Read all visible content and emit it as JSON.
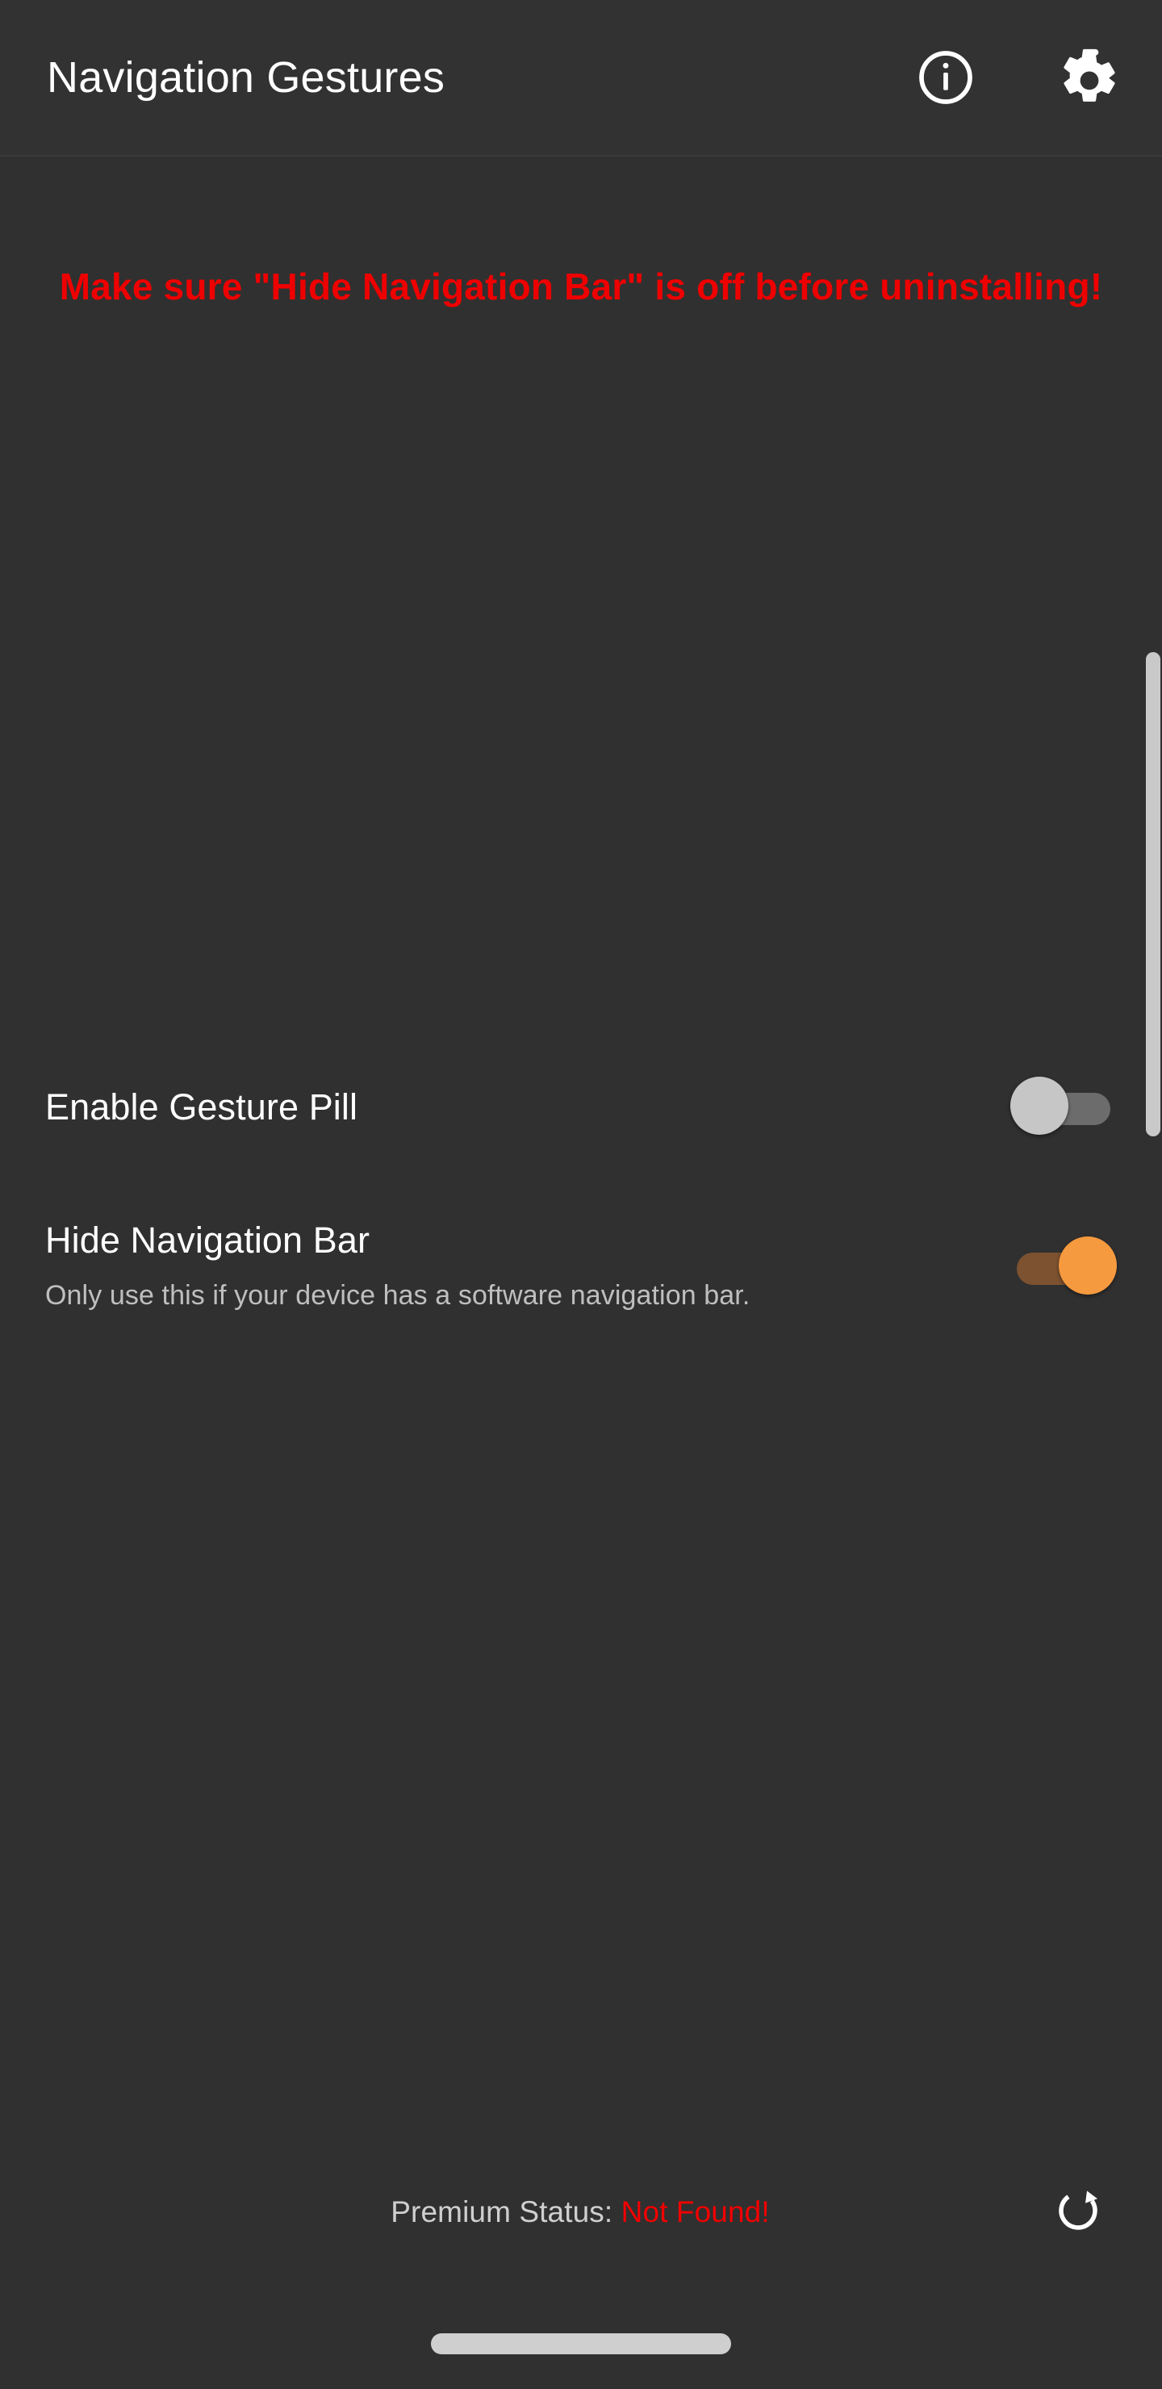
{
  "app": {
    "title": "Navigation Gestures",
    "theme": {
      "background": "#303030",
      "appbar_background": "#323232",
      "accent": "#f69a3f",
      "warning_red": "#ee0000",
      "primary_text": "#ffffff",
      "secondary_text": "#bfbfbf"
    }
  },
  "appbar": {
    "title": "Navigation Gestures",
    "actions": [
      {
        "name": "info-icon",
        "label": "Info"
      },
      {
        "name": "gear-icon",
        "label": "Settings"
      }
    ]
  },
  "warning": {
    "text": "Make sure \"Hide Navigation Bar\" is off before uninstalling!",
    "color": "#ee0000"
  },
  "preferences": [
    {
      "key": "enable_gesture_pill",
      "title": "Enable Gesture Pill",
      "summary": "",
      "switch_state": "off",
      "switch_label": "Off"
    },
    {
      "key": "hide_navigation_bar",
      "title": "Hide Navigation Bar",
      "summary": "Only use this if your device has a software navigation bar.",
      "switch_state": "on",
      "switch_label": "On"
    }
  ],
  "footer": {
    "premium_label": "Premium Status:",
    "premium_value": "Not Found!",
    "premium_value_color": "#f20000",
    "refresh": {
      "name": "refresh-icon",
      "label": "Refresh"
    }
  },
  "system_nav": {
    "home_indicator_label": "Home"
  }
}
